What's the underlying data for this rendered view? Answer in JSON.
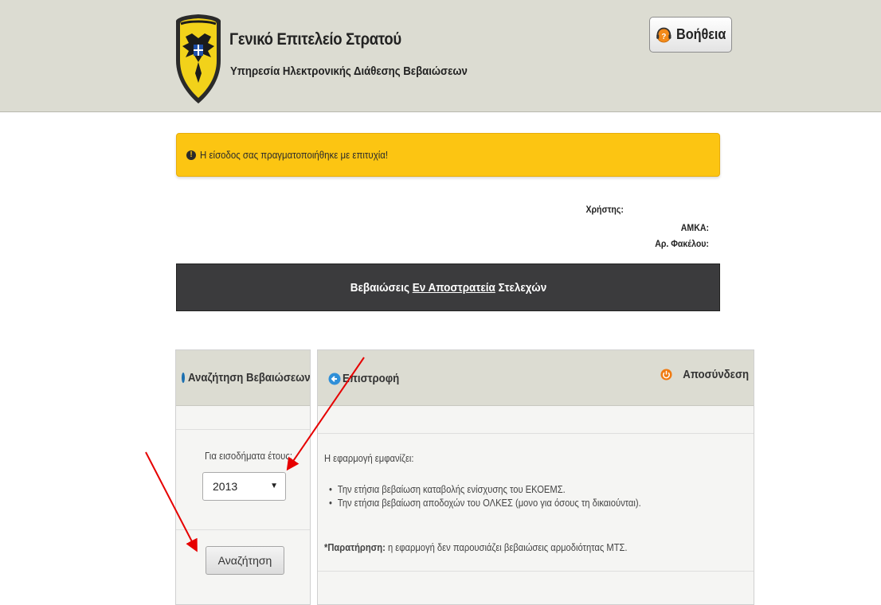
{
  "header": {
    "title": "Γενικό Επιτελείο Στρατού",
    "subtitle": "Υπηρεσία Ηλεκτρονικής Διάθεσης Βεβαιώσεων",
    "emblem_icon": "army-emblem-icon",
    "help_label": "Βοήθεια",
    "help_icon": "help-question-icon"
  },
  "alert": {
    "message": "Η είσοδος σας πραγματοποιήθηκε με επιτυχία!",
    "color": "#fcc512"
  },
  "user": {
    "user_label": "Χρήστης:",
    "amka_label": "ΑΜΚΑ:",
    "file_label": "Αρ. Φακέλου:"
  },
  "title_bar": {
    "prefix": "Βεβαιώσεις",
    "underlined": "Εν Αποστρατεία",
    "suffix": "Στελεχών"
  },
  "search_panel": {
    "heading": "Αναζήτηση Βεβαιώσεων",
    "year_label": "Για εισοδήματα έτους:",
    "year_value": "2013",
    "search_button": "Αναζήτηση"
  },
  "info_panel": {
    "back_label": "Επιστροφή",
    "logout_label": "Αποσύνδεση",
    "intro": "Η εφαρμογή εμφανίζει:",
    "items": [
      "Την ετήσια βεβαίωση καταβολής ενίσχυσης του ΕΚΟΕΜΣ.",
      "Την ετήσια βεβαίωση αποδοχών του ΟΛΚΕΣ (μονο για όσους τη δικαιούνται)."
    ],
    "note_label": "*Παρατήρηση:",
    "note_text": "η εφαρμογή δεν παρουσιάζει βεβαιώσεις αρμοδιότητας ΜΤΣ."
  },
  "colors": {
    "header_bg": "#dcdcd2",
    "title_bar_bg": "#3b3b3d",
    "annotation_arrow": "#e60000"
  }
}
